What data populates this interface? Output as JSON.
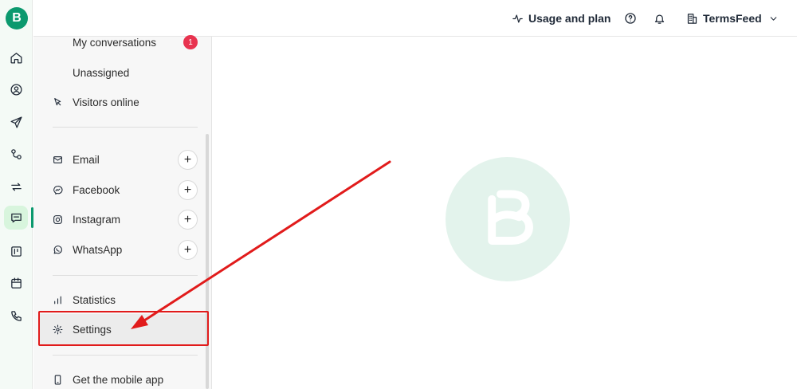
{
  "rail": {
    "logo": "B",
    "icons": [
      "home-icon",
      "contacts-icon",
      "campaigns-icon",
      "automations-icon",
      "transactional-icon",
      "conversations-icon",
      "deals-icon",
      "meetings-icon",
      "phone-icon"
    ],
    "active": "conversations-icon"
  },
  "topbar": {
    "usage_label": "Usage and plan",
    "account_label": "TermsFeed"
  },
  "sidebar": {
    "my_conversations": "My conversations",
    "my_conversations_badge": "1",
    "unassigned": "Unassigned",
    "visitors_online": "Visitors online",
    "channels": [
      {
        "label": "Email",
        "icon": "mail-icon"
      },
      {
        "label": "Facebook",
        "icon": "messenger-icon"
      },
      {
        "label": "Instagram",
        "icon": "instagram-icon"
      },
      {
        "label": "WhatsApp",
        "icon": "whatsapp-icon"
      }
    ],
    "add_symbol": "+",
    "statistics": "Statistics",
    "settings": "Settings",
    "mobile_app": "Get the mobile app"
  },
  "main": {
    "watermark_logo": "B"
  },
  "colors": {
    "brand": "#0b996e",
    "badge": "#e8334f",
    "annotation": "#e11b1b"
  }
}
